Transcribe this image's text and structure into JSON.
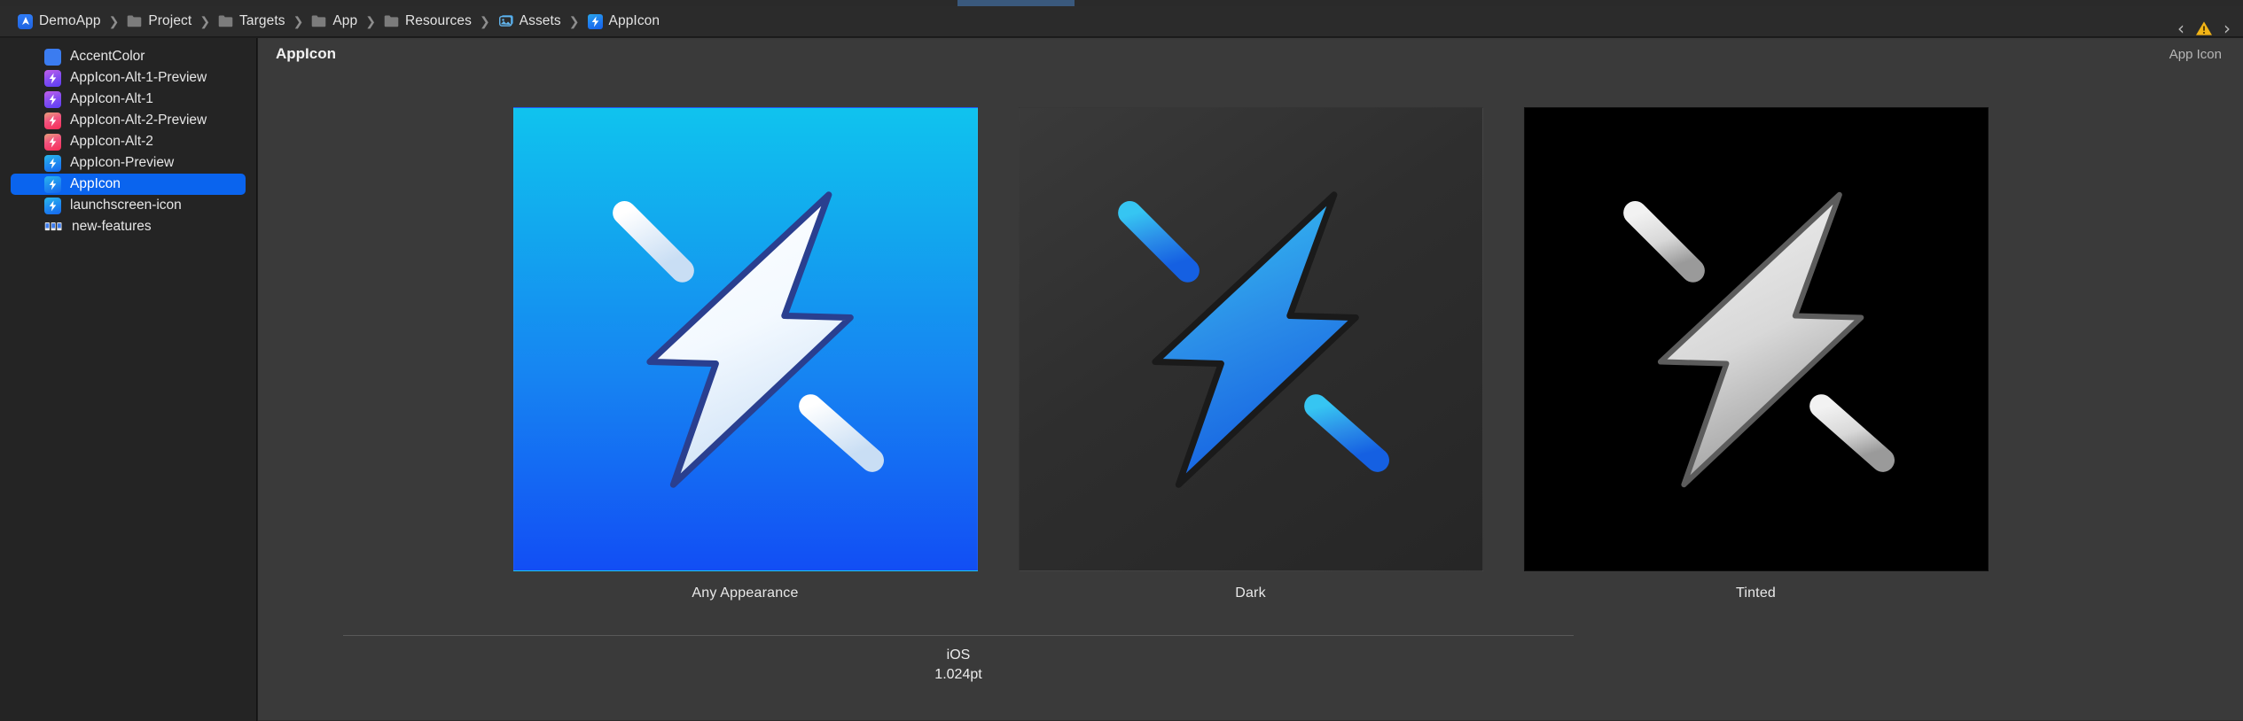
{
  "window": {
    "accent_color": "#3a597d",
    "chrome_color": "#2a2a2a"
  },
  "breadcrumb": {
    "items": [
      {
        "label": "DemoApp",
        "icon": "xcode-project-icon"
      },
      {
        "label": "Project",
        "icon": "folder-icon"
      },
      {
        "label": "Targets",
        "icon": "folder-icon"
      },
      {
        "label": "App",
        "icon": "folder-icon"
      },
      {
        "label": "Resources",
        "icon": "folder-icon"
      },
      {
        "label": "Assets",
        "icon": "assets-catalog-icon"
      },
      {
        "label": "AppIcon",
        "icon": "app-icon-asset-icon"
      }
    ],
    "separator": "❯",
    "nav_back": "‹",
    "nav_forward": "›",
    "warning_icon": "warning-triangle-icon"
  },
  "sidebar": {
    "items": [
      {
        "label": "AccentColor",
        "icon": "color-swatch-icon",
        "style": "sq-accent",
        "selected": false
      },
      {
        "label": "AppIcon-Alt-1-Preview",
        "icon": "app-icon-asset-icon",
        "style": "sq-purple",
        "selected": false
      },
      {
        "label": "AppIcon-Alt-1",
        "icon": "app-icon-asset-icon",
        "style": "sq-purple",
        "selected": false
      },
      {
        "label": "AppIcon-Alt-2-Preview",
        "icon": "app-icon-asset-icon",
        "style": "sq-pink",
        "selected": false
      },
      {
        "label": "AppIcon-Alt-2",
        "icon": "app-icon-asset-icon",
        "style": "sq-pink",
        "selected": false
      },
      {
        "label": "AppIcon-Preview",
        "icon": "app-icon-asset-icon",
        "style": "sq-blue",
        "selected": false
      },
      {
        "label": "AppIcon",
        "icon": "app-icon-asset-icon",
        "style": "sq-blue",
        "selected": true
      },
      {
        "label": "launchscreen-icon",
        "icon": "app-icon-asset-icon",
        "style": "sq-blue",
        "selected": false
      },
      {
        "label": "new-features",
        "icon": "image-set-icon",
        "style": "imgstack",
        "selected": false
      }
    ],
    "selection_color": "#0a64ee"
  },
  "content": {
    "title": "AppIcon",
    "kind": "App Icon",
    "appearances": [
      {
        "caption": "Any Appearance",
        "background": "gradient cyan to blue",
        "bg_top": "#10c3ee",
        "bg_bottom": "#124ef4",
        "bolt_style": "white",
        "art": "lightning-bolt-icon"
      },
      {
        "caption": "Dark",
        "background": "dark gray",
        "bg_top": "#3a3a3a",
        "bg_bottom": "#262626",
        "bolt_style": "blue",
        "art": "lightning-bolt-icon"
      },
      {
        "caption": "Tinted",
        "background": "black",
        "bg_top": "#000000",
        "bg_bottom": "#000000",
        "bolt_style": "gray",
        "art": "lightning-bolt-icon"
      }
    ],
    "platform": "iOS",
    "size": "1.024pt"
  }
}
